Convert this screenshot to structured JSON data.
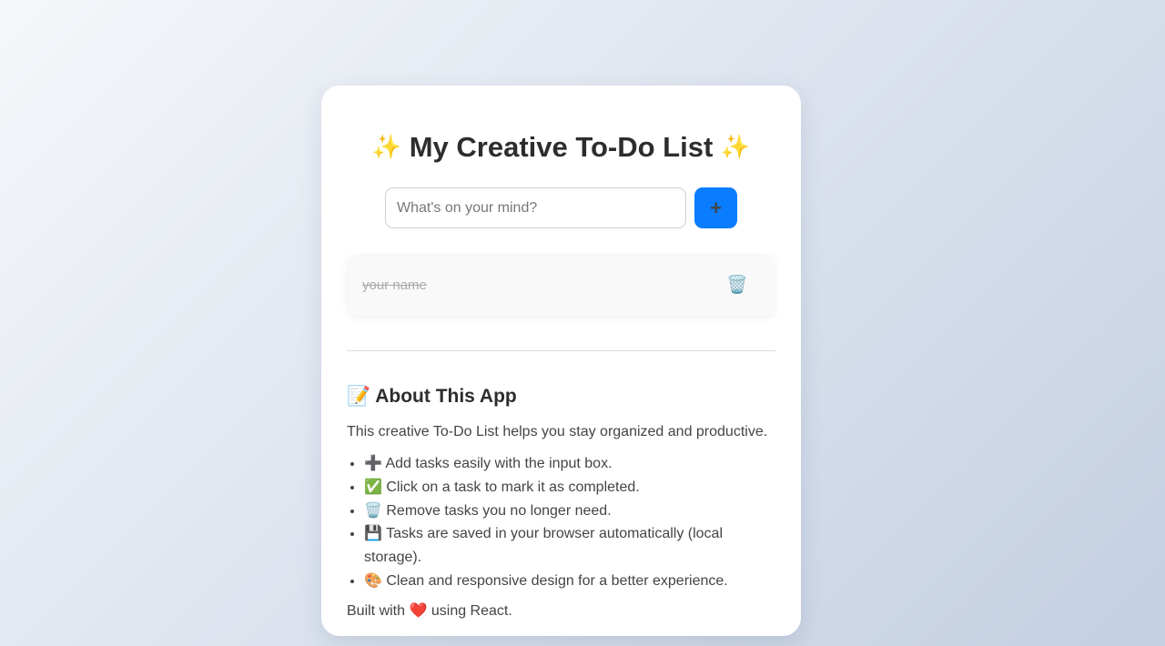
{
  "app": {
    "title": "My Creative To-Do List",
    "title_icon": "✨"
  },
  "input": {
    "placeholder": "What's on your mind?",
    "value": "",
    "add_label": "+"
  },
  "tasks": [
    {
      "text": "your name",
      "completed": true,
      "delete_icon": "🗑️"
    }
  ],
  "about": {
    "heading_icon": "📝",
    "heading": "About This App",
    "description": "This creative To-Do List helps you stay organized and productive.",
    "features": [
      {
        "icon": "➕",
        "text": "Add tasks easily with the input box."
      },
      {
        "icon": "✅",
        "text": "Click on a task to mark it as completed."
      },
      {
        "icon": "🗑️",
        "text": "Remove tasks you no longer need."
      },
      {
        "icon": "💾",
        "text": "Tasks are saved in your browser automatically (local storage)."
      },
      {
        "icon": "🎨",
        "text": "Clean and responsive design for a better experience."
      }
    ],
    "built_prefix": "Built with",
    "built_heart": "❤️",
    "built_suffix": "using React."
  },
  "colors": {
    "accent": "#0a7cff",
    "background_start": "#f5f7fa",
    "background_end": "#c3cfe2"
  }
}
